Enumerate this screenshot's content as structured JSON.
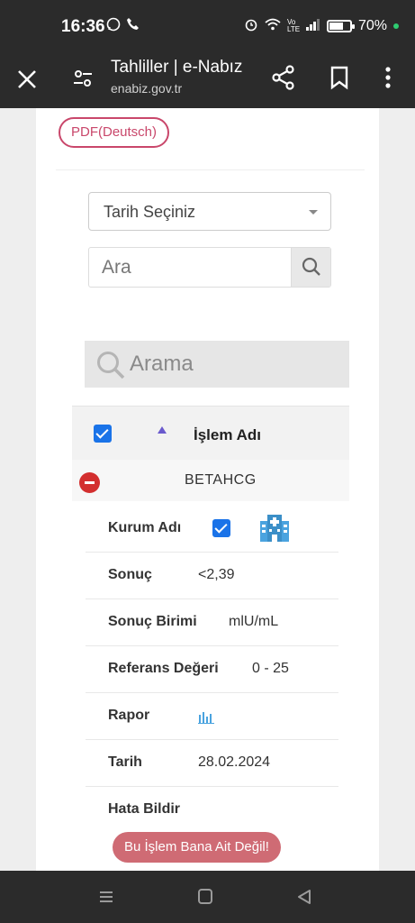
{
  "status_bar": {
    "time": "16:36",
    "battery": "70%",
    "battery_level": 0.7,
    "network": "Vo LTE"
  },
  "browser": {
    "title": "Tahliller | e-Nabız",
    "url": "enabiz.gov.tr"
  },
  "pdf_button": "PDF(Deutsch)",
  "date_select": {
    "selected": "Tarih Seçiniz"
  },
  "search": {
    "placeholder": "Ara"
  },
  "filter": {
    "placeholder": "Arama"
  },
  "table": {
    "header": "İşlem Adı",
    "group": "BETAHCG",
    "details": [
      {
        "key": "Kurum Adı",
        "value": ""
      },
      {
        "key": "Sonuç",
        "value": "<2,39"
      },
      {
        "key": "Sonuç Birimi",
        "value": "mlU/mL"
      },
      {
        "key": "Referans Değeri",
        "value": "0 - 25"
      },
      {
        "key": "Rapor",
        "value": ""
      },
      {
        "key": "Tarih",
        "value": "28.02.2024"
      },
      {
        "key": "Hata Bildir",
        "value": ""
      }
    ]
  },
  "report_button": "Bu İşlem Bana Ait Değil!",
  "colors": {
    "accent_pink": "#c9476b",
    "checkbox_blue": "#1a73e8",
    "danger_red": "#d32f2f",
    "button_pink": "#cf6b74",
    "icon_blue": "#4aa3df"
  }
}
